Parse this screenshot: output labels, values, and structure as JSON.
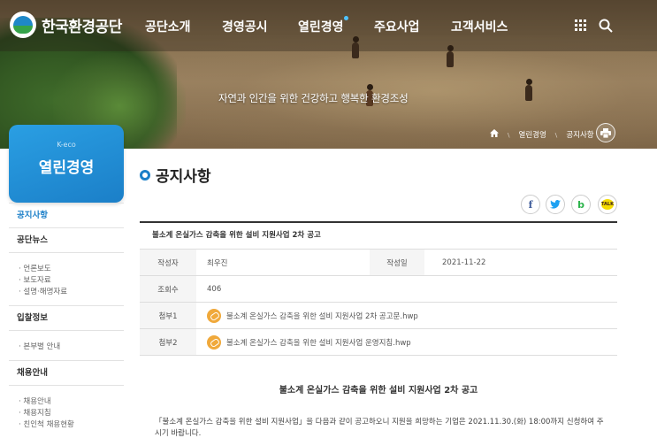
{
  "brand": {
    "logo_text": "한국환경공단",
    "side_sub": "K-eco"
  },
  "nav": {
    "items": [
      "공단소개",
      "경영공시",
      "열린경영",
      "주요사업",
      "고객서비스"
    ],
    "active_index": 2,
    "accent": "#4ec3ff"
  },
  "hero": {
    "slogan": "자연과 인간을 위한 건강하고 행복한 환경조성"
  },
  "breadcrumb": {
    "items": [
      "열린경영",
      "공지사항"
    ]
  },
  "sidebar": {
    "title": "열린경영",
    "menu": [
      {
        "label": "공지사항",
        "active": true
      },
      {
        "label": "공단뉴스"
      },
      {
        "sub": [
          "언론보도",
          "보도자료",
          "설명·해명자료"
        ]
      },
      {
        "label": "입찰정보"
      },
      {
        "sub": [
          "본부별 안내"
        ]
      },
      {
        "label": "채용안내"
      },
      {
        "sub": [
          "채용안내",
          "채용지침",
          "친인척 채용현황"
        ]
      }
    ],
    "accent": "#1b7fc8"
  },
  "page": {
    "title": "공지사항"
  },
  "share": {
    "facebook": "f",
    "twitter": "t",
    "blog": "b",
    "kakaostory": "TALK"
  },
  "post": {
    "subject": "불소계 온실가스 감축을 위한 설비 지원사업 2차 공고",
    "labels": {
      "author": "작성자",
      "date": "작성일",
      "views": "조회수",
      "attach1": "첨부1",
      "attach2": "첨부2"
    },
    "author": "최우진",
    "date": "2021-11-22",
    "views": "406",
    "attachments": [
      "불소계 온실가스 감축을 위한 설비 지원사업 2차 공고문.hwp",
      "불소계 온실가스 감축을 위한 설비 지원사업 운영지침.hwp"
    ],
    "content_title": "불소계 온실가스 감축을 위한 설비 지원사업 2차 공고",
    "content_text": "「불소계 온실가스 감축을 위한 설비 지원사업」을 다음과 같이 공고하오니 지원을 희망하는 기업은 2021.11.30.(화) 18:00까지 신청하여 주시기 바랍니다."
  }
}
